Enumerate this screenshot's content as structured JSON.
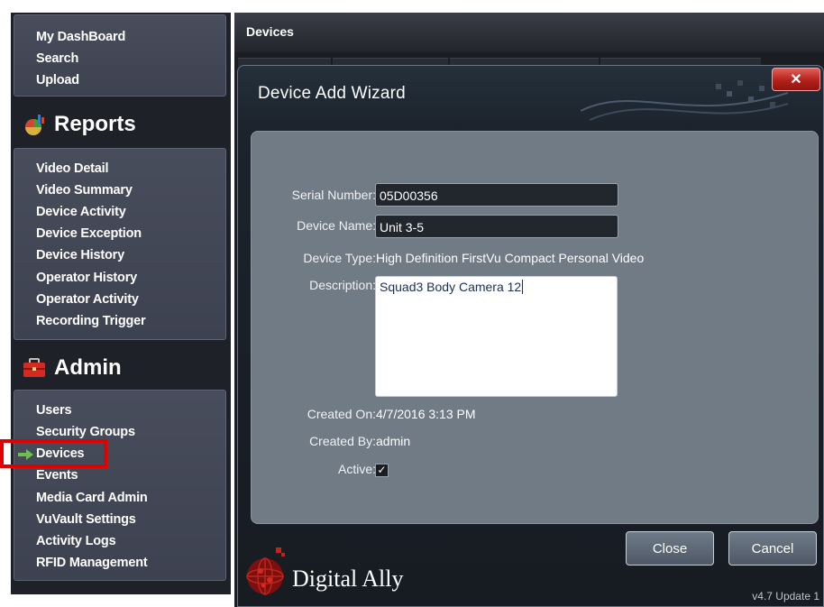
{
  "sidebar": {
    "top_items": [
      "My DashBoard",
      "Search",
      "Upload"
    ],
    "reports": {
      "title": "Reports",
      "icon": "chart-icon",
      "items": [
        "Video Detail",
        "Video Summary",
        "Device Activity",
        "Device Exception",
        "Device History",
        "Operator History",
        "Operator Activity",
        "Recording Trigger"
      ]
    },
    "admin": {
      "title": "Admin",
      "icon": "toolbox-icon",
      "items": [
        "Users",
        "Security Groups",
        "Devices",
        "Events",
        "Media Card Admin",
        "VuVault Settings",
        "Activity Logs",
        "RFID Management"
      ],
      "selected": "Devices"
    }
  },
  "main": {
    "title": "Devices"
  },
  "dialog": {
    "title": "Device Add Wizard",
    "close_label": "✕",
    "fields": {
      "serial_label": "Serial Number:",
      "serial_value": "05D00356",
      "name_label": "Device Name:",
      "name_value": "Unit 3-5",
      "type_label": "Device Type:",
      "type_value": "High Definition FirstVu Compact Personal Video",
      "description_label": "Description:",
      "description_value": "Squad3 Body Camera 12",
      "created_on_label": "Created On:",
      "created_on_value": "4/7/2016 3:13 PM",
      "created_by_label": "Created By:",
      "created_by_value": "admin",
      "active_label": "Active:",
      "active_value": "✓"
    },
    "buttons": {
      "close": "Close",
      "cancel": "Cancel"
    },
    "logo_text": "Digital Ally",
    "version": "v4.7 Update 1"
  },
  "colors": {
    "highlight": "#e00000",
    "arrow": "#6cc04a",
    "close_button": "#c0241d"
  }
}
